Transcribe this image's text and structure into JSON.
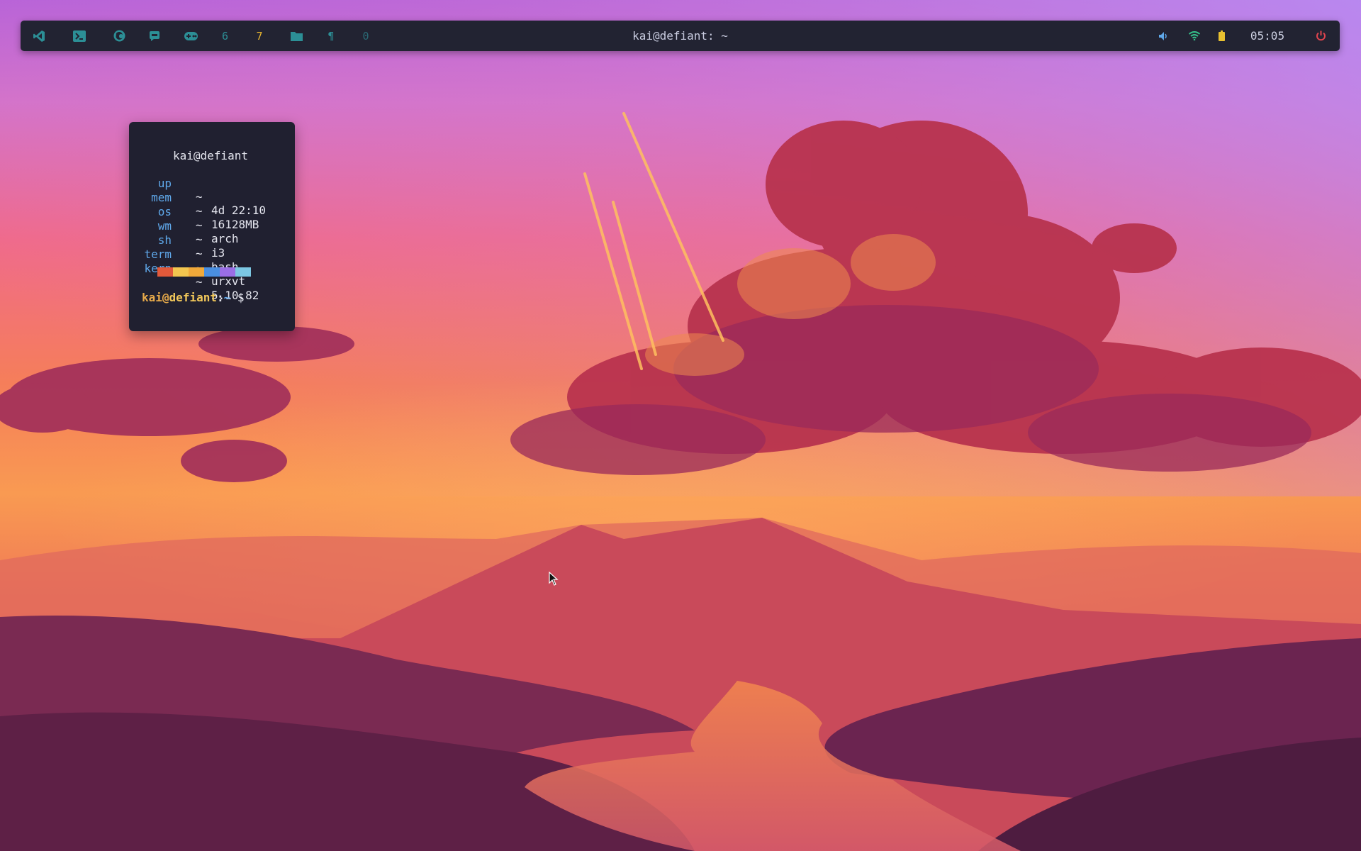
{
  "bar": {
    "workspaces": [
      {
        "icon": "vscode-icon",
        "label": ""
      },
      {
        "icon": "terminal-icon",
        "label": ""
      },
      {
        "icon": "firefox-icon",
        "label": ""
      },
      {
        "icon": "chat-icon",
        "label": ""
      },
      {
        "icon": "gamepad-icon",
        "label": ""
      },
      {
        "icon": "",
        "label": "6"
      },
      {
        "icon": "",
        "label": "7"
      },
      {
        "icon": "folder-icon",
        "label": ""
      },
      {
        "icon": "pilcrow-icon",
        "label": "¶"
      },
      {
        "icon": "",
        "label": "0"
      }
    ],
    "title": "kai@defiant: ~",
    "tray": {
      "volume_icon": "volume-icon",
      "wifi_icon": "wifi-icon",
      "battery_icon": "battery-icon",
      "clock": "05:05",
      "power_icon": "power-icon"
    },
    "colors": {
      "bar_bg": "#222332",
      "workspace_icon": "#2c8f96",
      "active_workspace": "#e8b52f",
      "wifi": "#35c08a",
      "battery": "#e8c030",
      "power": "#e0444e"
    }
  },
  "terminal": {
    "fetch": {
      "user": "kai@defiant",
      "rows": [
        {
          "key": "up",
          "sep": "~",
          "value": "4d 22:10"
        },
        {
          "key": "mem",
          "sep": "~",
          "value": "16128MB"
        },
        {
          "key": "os",
          "sep": "~",
          "value": "arch"
        },
        {
          "key": "wm",
          "sep": "~",
          "value": "i3"
        },
        {
          "key": "sh",
          "sep": "~",
          "value": "bash"
        },
        {
          "key": "term",
          "sep": "~",
          "value": "urxvt"
        },
        {
          "key": "kern",
          "sep": "~",
          "value": "5.10.82"
        }
      ],
      "palette": [
        "#e2593a",
        "#f3c64f",
        "#f0a93a",
        "#4a8fe0",
        "#9a6ee6",
        "#7cc7e3"
      ]
    },
    "prompt": {
      "user": "kai",
      "at": "@",
      "host": "defiant",
      "colon": ":",
      "path": "~",
      "symbol": "$"
    }
  }
}
